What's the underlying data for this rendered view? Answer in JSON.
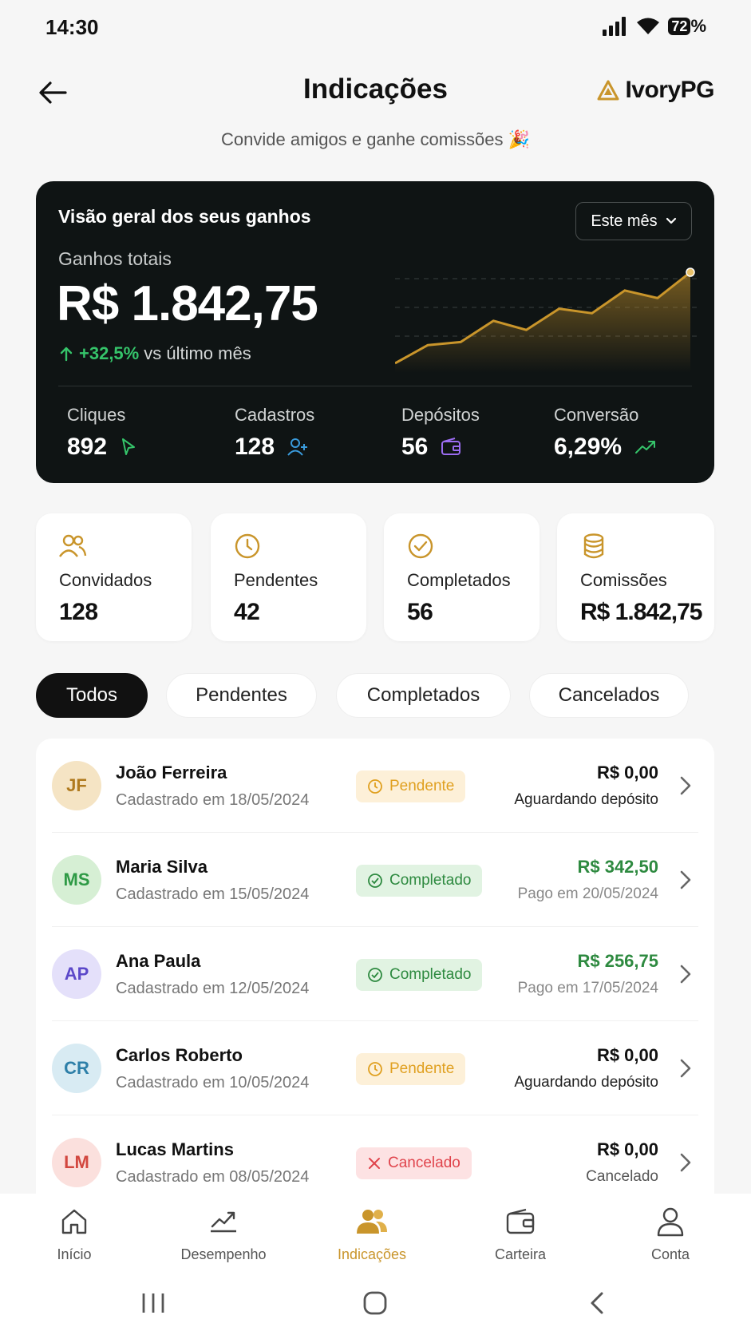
{
  "status_bar": {
    "time": "14:30",
    "battery": "72",
    "battery_suffix": "%"
  },
  "header": {
    "title": "Indicações",
    "brand": "IvoryPG",
    "subtitle": "Convide amigos e ganhe comissões 🎉"
  },
  "earnings": {
    "title": "Visão geral dos seus ganhos",
    "period": "Este mês",
    "total_label": "Ganhos totais",
    "total_value": "R$ 1.842,75",
    "growth_pct": "+32,5%",
    "growth_text": "vs último mês",
    "trend_points": [
      10,
      22,
      24,
      38,
      32,
      46,
      43,
      58,
      53,
      70
    ],
    "stats": [
      {
        "label": "Cliques",
        "value": "892",
        "icon": "cursor-icon"
      },
      {
        "label": "Cadastros",
        "value": "128",
        "icon": "user-plus-icon"
      },
      {
        "label": "Depósitos",
        "value": "56",
        "icon": "wallet-icon"
      },
      {
        "label": "Conversão",
        "value": "6,29%",
        "icon": "trending-up-icon"
      }
    ]
  },
  "summary": [
    {
      "label": "Convidados",
      "value": "128",
      "icon": "users-icon"
    },
    {
      "label": "Pendentes",
      "value": "42",
      "icon": "clock-icon"
    },
    {
      "label": "Completados",
      "value": "56",
      "icon": "check-circle-icon"
    },
    {
      "label": "Comissões",
      "value": "R$ 1.842,75",
      "icon": "coins-icon"
    }
  ],
  "tabs": [
    "Todos",
    "Pendentes",
    "Completados",
    "Cancelados"
  ],
  "referrals": [
    {
      "initials": "JF",
      "name": "João Ferreira",
      "date": "Cadastrado em 18/05/2024",
      "status": "Pendente",
      "amount": "R$ 0,00",
      "note": "Aguardando depósito"
    },
    {
      "initials": "MS",
      "name": "Maria Silva",
      "date": "Cadastrado em 15/05/2024",
      "status": "Completado",
      "amount": "R$ 342,50",
      "note": "Pago em 20/05/2024"
    },
    {
      "initials": "AP",
      "name": "Ana Paula",
      "date": "Cadastrado em 12/05/2024",
      "status": "Completado",
      "amount": "R$ 256,75",
      "note": "Pago em 17/05/2024"
    },
    {
      "initials": "CR",
      "name": "Carlos Roberto",
      "date": "Cadastrado em 10/05/2024",
      "status": "Pendente",
      "amount": "R$ 0,00",
      "note": "Aguardando depósito"
    },
    {
      "initials": "LM",
      "name": "Lucas Martins",
      "date": "Cadastrado em 08/05/2024",
      "status": "Cancelado",
      "amount": "R$ 0,00",
      "note": "Cancelado"
    }
  ],
  "nav": [
    {
      "label": "Início",
      "icon": "home-icon"
    },
    {
      "label": "Desempenho",
      "icon": "chart-icon"
    },
    {
      "label": "Indicações",
      "icon": "users-icon"
    },
    {
      "label": "Carteira",
      "icon": "wallet-icon"
    },
    {
      "label": "Conta",
      "icon": "person-icon"
    }
  ],
  "colors": {
    "accent": "#c9952b",
    "dark_card": "#0f1414",
    "green": "#2e9a45",
    "pending": "#e0a020",
    "cancel": "#e0444c"
  }
}
